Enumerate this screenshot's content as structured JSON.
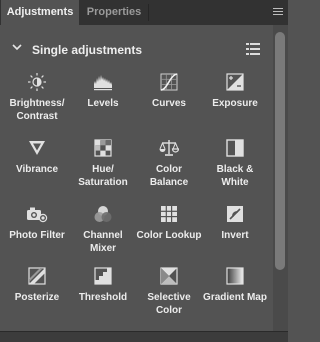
{
  "tabs": [
    {
      "label": "Adjustments",
      "active": true
    },
    {
      "label": "Properties",
      "active": false
    }
  ],
  "section": {
    "title": "Single adjustments",
    "expanded": true
  },
  "items": [
    {
      "label": "Brightness/ Contrast",
      "icon": "brightness-contrast-icon"
    },
    {
      "label": "Levels",
      "icon": "levels-icon"
    },
    {
      "label": "Curves",
      "icon": "curves-icon"
    },
    {
      "label": "Exposure",
      "icon": "exposure-icon"
    },
    {
      "label": "Vibrance",
      "icon": "vibrance-icon"
    },
    {
      "label": "Hue/ Saturation",
      "icon": "hue-saturation-icon"
    },
    {
      "label": "Color Balance",
      "icon": "color-balance-icon"
    },
    {
      "label": "Black & White",
      "icon": "black-white-icon"
    },
    {
      "label": "Photo Filter",
      "icon": "photo-filter-icon"
    },
    {
      "label": "Channel Mixer",
      "icon": "channel-mixer-icon"
    },
    {
      "label": "Color Lookup",
      "icon": "color-lookup-icon"
    },
    {
      "label": "Invert",
      "icon": "invert-icon"
    },
    {
      "label": "Posterize",
      "icon": "posterize-icon"
    },
    {
      "label": "Threshold",
      "icon": "threshold-icon"
    },
    {
      "label": "Selective Color",
      "icon": "selective-color-icon"
    },
    {
      "label": "Gradient Map",
      "icon": "gradient-map-icon"
    }
  ],
  "colors": {
    "panel_bg": "#535353",
    "tabbar_bg": "#323232",
    "text": "#eaeaea",
    "inactive_tab_text": "#9a9a9a"
  }
}
